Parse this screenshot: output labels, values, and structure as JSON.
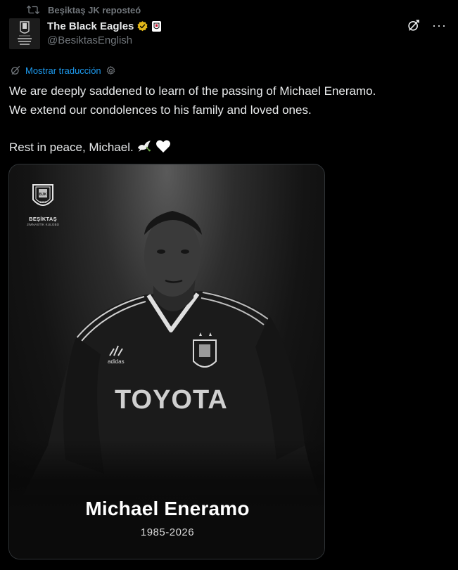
{
  "repost": {
    "text": "Beşiktaş JK reposteó",
    "icon": "repost-icon"
  },
  "author": {
    "name": "The Black Eagles",
    "handle": "@BesiktasEnglish",
    "verified": true,
    "verified_color": "#e2b719",
    "avatar_text": "BLACK EAGLES"
  },
  "actions": {
    "grok_icon": "grok-icon",
    "more_label": "···"
  },
  "translate": {
    "label": "Mostrar traducción",
    "color": "#1d9bf0"
  },
  "tweet": {
    "line1": "We are deeply saddened to learn of the passing of Michael Eneramo.",
    "line2": "We extend our condolences to his family and loved ones.",
    "line3": "Rest in peace, Michael.",
    "emojis": [
      "dove-icon",
      "white-heart-icon"
    ]
  },
  "media": {
    "club_name": "BEŞİKTAŞ",
    "club_sub": "JİMNASTİK KULÜBÜ",
    "badge_text": "BJK",
    "badge_year": "1903",
    "player_name": "Michael Eneramo",
    "years": "1985-2026",
    "shirt_sponsor": "TOYOTA",
    "kit_brand": "adidas"
  }
}
